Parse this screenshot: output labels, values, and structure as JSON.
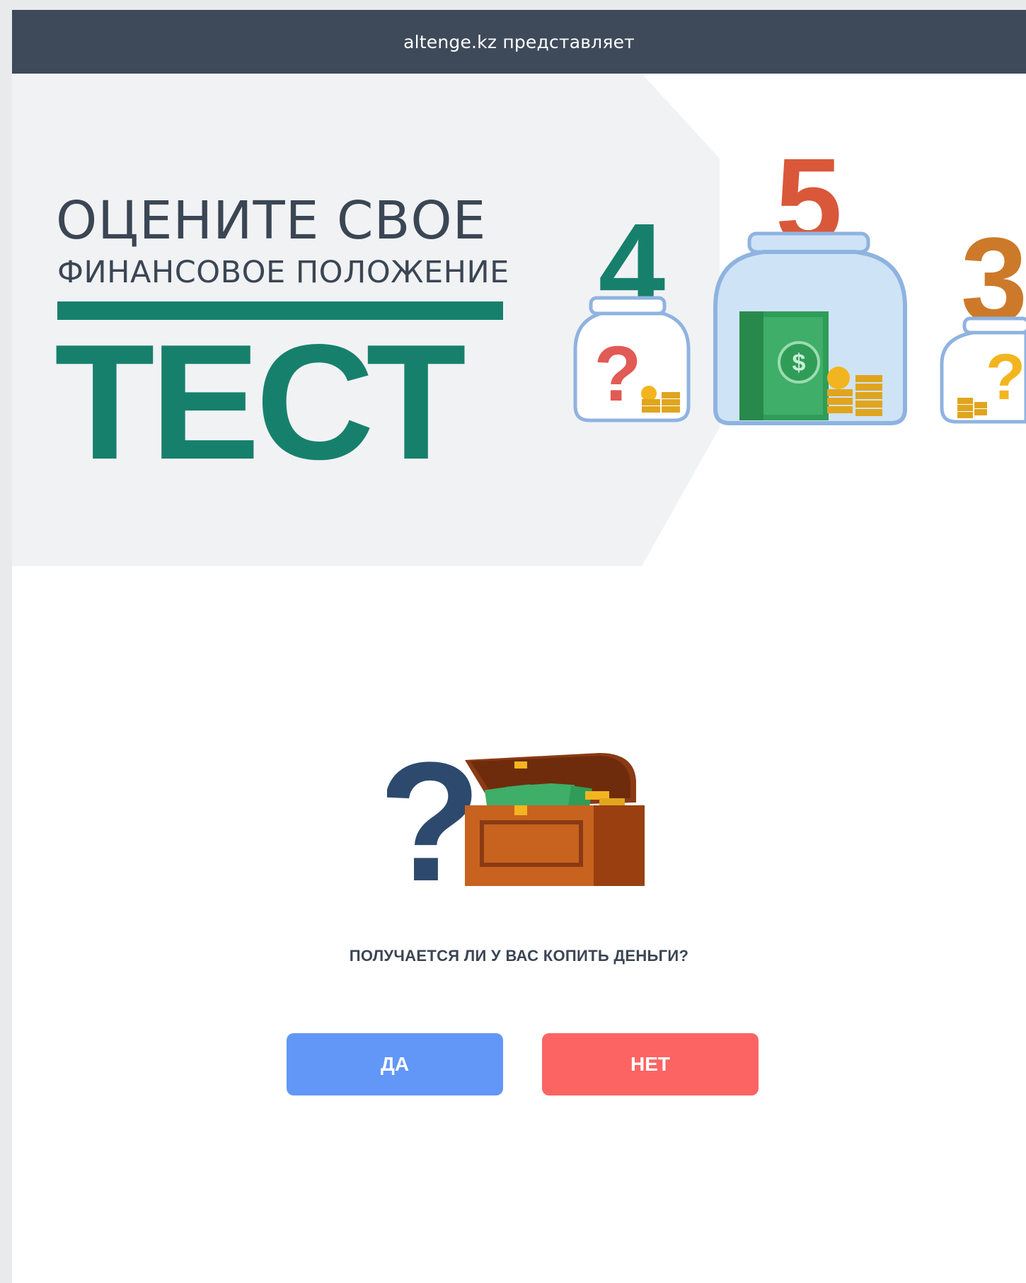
{
  "header": {
    "text": "altenge.kz представляет"
  },
  "hero": {
    "title_line1": "ОЦЕНИТЕ СВОЕ",
    "title_line2": "ФИНАНСОВОЕ ПОЛОЖЕНИЕ",
    "title_big": "ТЕСТ",
    "jars": [
      {
        "number": "4",
        "color": "#17806c"
      },
      {
        "number": "5",
        "color": "#d9583a"
      },
      {
        "number": "3",
        "color": "#cc7a2a"
      }
    ],
    "colors": {
      "accent_green": "#17806c",
      "hero_background": "#f1f2f4"
    }
  },
  "quiz": {
    "illustration": "treasure-chest-with-question-mark",
    "question": "ПОЛУЧАЕТСЯ ЛИ У ВАС КОПИТЬ ДЕНЬГИ?",
    "yes_label": "ДА",
    "no_label": "НЕТ",
    "colors": {
      "yes": "#6297f8",
      "no": "#fc6464"
    }
  }
}
